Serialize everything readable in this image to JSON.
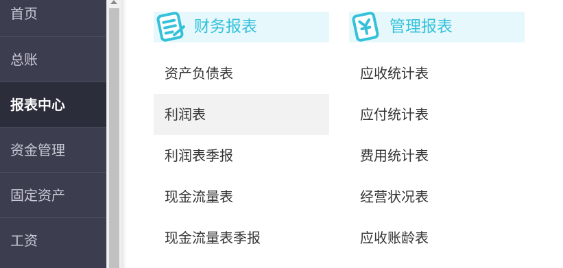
{
  "sidebar": {
    "items": [
      {
        "label": "首页"
      },
      {
        "label": "总账"
      },
      {
        "label": "报表中心"
      },
      {
        "label": "资金管理"
      },
      {
        "label": "固定资产"
      },
      {
        "label": "工资"
      }
    ],
    "active_index": 2
  },
  "panels": [
    {
      "title": "财务报表",
      "icon": "document-edit-icon",
      "items": [
        {
          "label": "资产负债表"
        },
        {
          "label": "利润表"
        },
        {
          "label": "利润表季报"
        },
        {
          "label": "现金流量表"
        },
        {
          "label": "现金流量表季报"
        }
      ],
      "highlighted_index": 1
    },
    {
      "title": "管理报表",
      "icon": "yuan-document-icon",
      "items": [
        {
          "label": "应收统计表"
        },
        {
          "label": "应付统计表"
        },
        {
          "label": "费用统计表"
        },
        {
          "label": "经营状况表"
        },
        {
          "label": "应收账龄表"
        }
      ]
    }
  ],
  "colors": {
    "sidebar_bg": "#3c3d4f",
    "sidebar_active_bg": "#2c2d3a",
    "accent": "#34c1d9",
    "panel_header_bg": "#e6f8fc",
    "hover_row": "#f2f2f2"
  }
}
